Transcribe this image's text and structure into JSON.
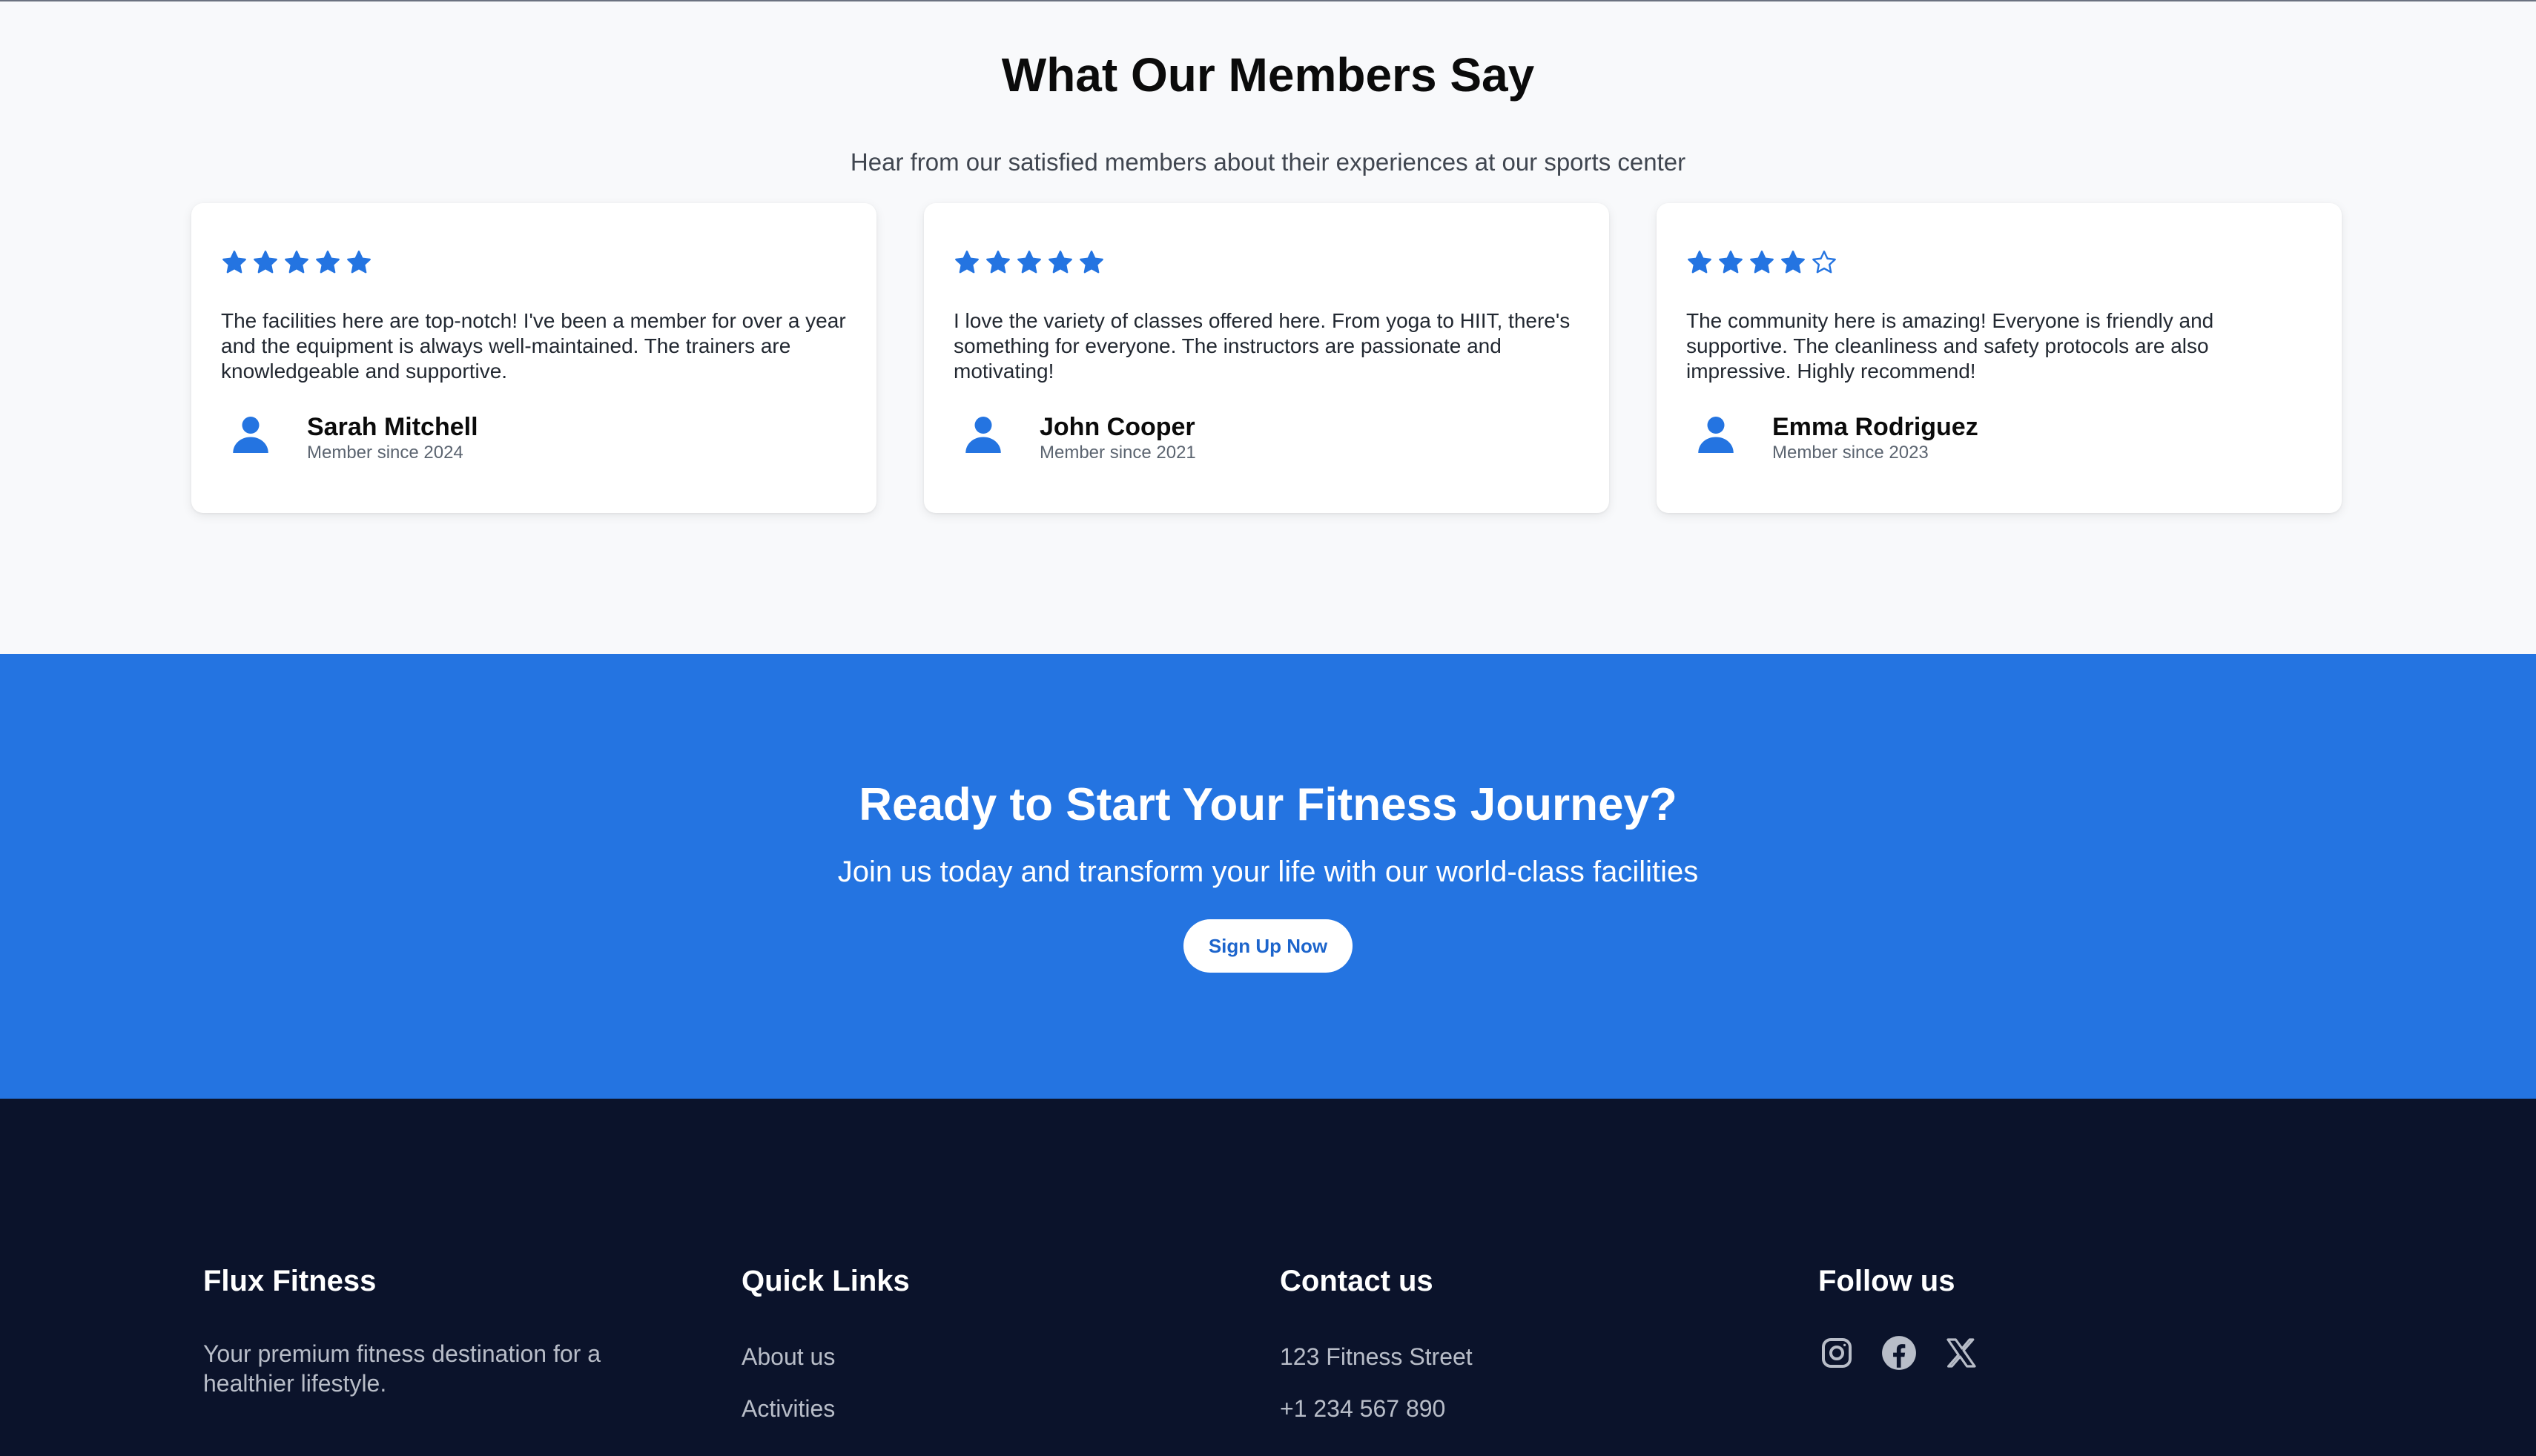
{
  "testimonials": {
    "title": "What Our Members Say",
    "subtitle": "Hear from our satisfied members about their experiences at our sports center",
    "items": [
      {
        "rating": 5,
        "max_rating": 5,
        "quote": "The facilities here are top-notch! I've been a member for over a year and the equipment is always well-maintained. The trainers are knowledgeable and supportive.",
        "name": "Sarah Mitchell",
        "since": "Member since 2024",
        "avatar_icon": "user-icon"
      },
      {
        "rating": 5,
        "max_rating": 5,
        "quote": "I love the variety of classes offered here. From yoga to HIIT, there's something for everyone. The instructors are passionate and motivating!",
        "name": "John Cooper",
        "since": "Member since 2021",
        "avatar_icon": "user-icon"
      },
      {
        "rating": 4,
        "max_rating": 5,
        "quote": "The community here is amazing! Everyone is friendly and supportive. The cleanliness and safety protocols are also impressive. Highly recommend!",
        "name": "Emma Rodriguez",
        "since": "Member since 2023",
        "avatar_icon": "user-icon"
      }
    ]
  },
  "cta": {
    "title": "Ready to Start Your Fitness Journey?",
    "subtitle": "Join us today and transform your life with our world-class facilities",
    "button_label": "Sign Up Now"
  },
  "footer": {
    "brand": {
      "title": "Flux Fitness",
      "description": "Your premium fitness destination for a healthier lifestyle."
    },
    "quick_links": {
      "title": "Quick Links",
      "links": [
        "About us",
        "Activities"
      ]
    },
    "contact": {
      "title": "Contact us",
      "lines": [
        "123 Fitness Street",
        "+1 234 567 890"
      ]
    },
    "follow": {
      "title": "Follow us",
      "icons": [
        "instagram-icon",
        "facebook-icon",
        "x-icon"
      ]
    }
  },
  "colors": {
    "accent": "#2474e1",
    "star": "#2474e1",
    "footer_bg": "#0b132b",
    "section_bg": "#f8f9fb"
  }
}
